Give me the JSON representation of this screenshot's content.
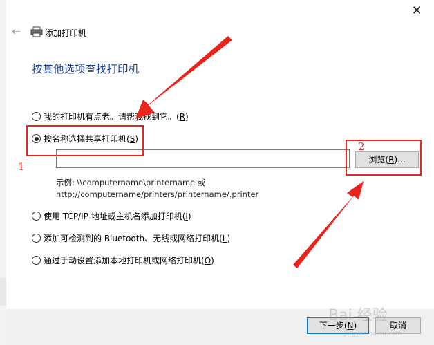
{
  "window": {
    "title": "添加打印机"
  },
  "heading": "按其他选项查找打印机",
  "options": [
    {
      "label": "我的打印机有点老。请帮我找到它。(",
      "key": "R",
      "tail": ")",
      "checked": false
    },
    {
      "label": "按名称选择共享打印机(",
      "key": "S",
      "tail": ")",
      "checked": true
    },
    {
      "label": "使用 TCP/IP 地址或主机名添加打印机(",
      "key": "I",
      "tail": ")",
      "checked": false
    },
    {
      "label": "添加可检测到的 Bluetooth、无线或网络打印机(",
      "key": "L",
      "tail": ")",
      "checked": false
    },
    {
      "label": "通过手动设置添加本地打印机或网络打印机(",
      "key": "O",
      "tail": ")",
      "checked": false
    }
  ],
  "share_input": {
    "value": ""
  },
  "browse_button": {
    "label": "浏览(",
    "key": "R",
    "tail": ")..."
  },
  "example": {
    "line1": "示例: \\\\computername\\printername 或",
    "line2": "http://computername/printers/printername/.printer"
  },
  "footer": {
    "next_label": "下一步(",
    "next_key": "N",
    "next_tail": ")",
    "cancel_label": "取消"
  },
  "annotations": {
    "num1": "1",
    "num2": "2",
    "color": "#e8241c"
  },
  "watermark": {
    "text": "Bai 经验",
    "sub": "jingyan.baidu.com"
  },
  "icons": {
    "back": "back-arrow-icon",
    "printer": "printer-icon",
    "close": "close-icon"
  }
}
